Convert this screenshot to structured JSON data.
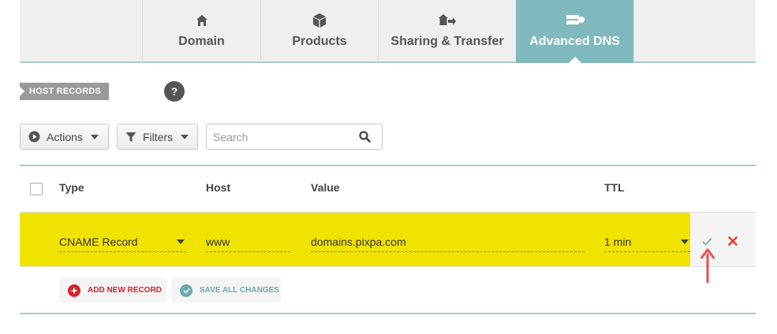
{
  "tabs": [
    {
      "label": "Domain",
      "icon": "home-icon",
      "active": false
    },
    {
      "label": "Products",
      "icon": "box-icon",
      "active": false
    },
    {
      "label": "Sharing & Transfer",
      "icon": "share-transfer-icon",
      "active": false
    },
    {
      "label": "Advanced DNS",
      "icon": "server-icon",
      "active": true
    }
  ],
  "section": {
    "label": "HOST RECORDS",
    "help": "?"
  },
  "toolbar": {
    "actions_label": "Actions",
    "filters_label": "Filters",
    "search_placeholder": "Search"
  },
  "table": {
    "headers": {
      "type": "Type",
      "host": "Host",
      "value": "Value",
      "ttl": "TTL"
    },
    "row": {
      "type": "CNAME Record",
      "host": "www",
      "value": "domains.pixpa.com",
      "ttl": "1 min"
    }
  },
  "buttons": {
    "add_record": "ADD NEW RECORD",
    "save_changes": "SAVE ALL CHANGES"
  },
  "colors": {
    "accent": "#7fb9bd",
    "highlight": "#f1e300",
    "add_red": "#d9202a",
    "save_teal": "#6fa9ad",
    "arrow_red": "#e8514b"
  }
}
